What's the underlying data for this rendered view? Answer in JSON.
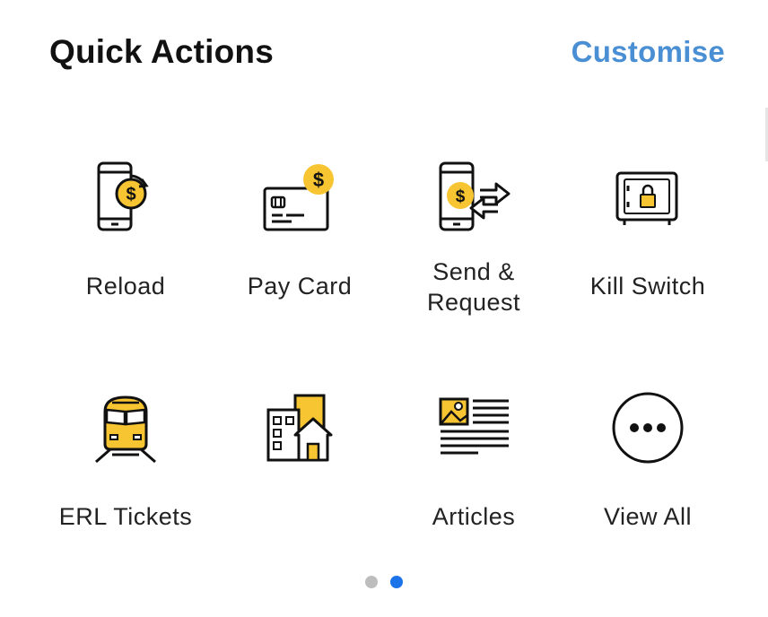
{
  "header": {
    "title": "Quick Actions",
    "customise_label": "Customise"
  },
  "actions": [
    {
      "label": "Reload",
      "icon": "phone-reload-dollar-icon"
    },
    {
      "label": "Pay Card",
      "icon": "credit-card-dollar-icon"
    },
    {
      "label": "Send &\nRequest",
      "icon": "phone-send-request-icon"
    },
    {
      "label": "Kill Switch",
      "icon": "safe-lock-icon"
    },
    {
      "label": "ERL Tickets",
      "icon": "train-icon"
    },
    {
      "label": "",
      "icon": "buildings-house-icon"
    },
    {
      "label": "Articles",
      "icon": "article-icon"
    },
    {
      "label": "View All",
      "icon": "more-circle-icon"
    }
  ],
  "pagination": {
    "pages": 2,
    "current": 2
  },
  "colors": {
    "accent_yellow": "#f7c531",
    "link_blue": "#4a8fd4",
    "active_dot": "#1a73e8",
    "inactive_dot": "#bdbdbd"
  }
}
